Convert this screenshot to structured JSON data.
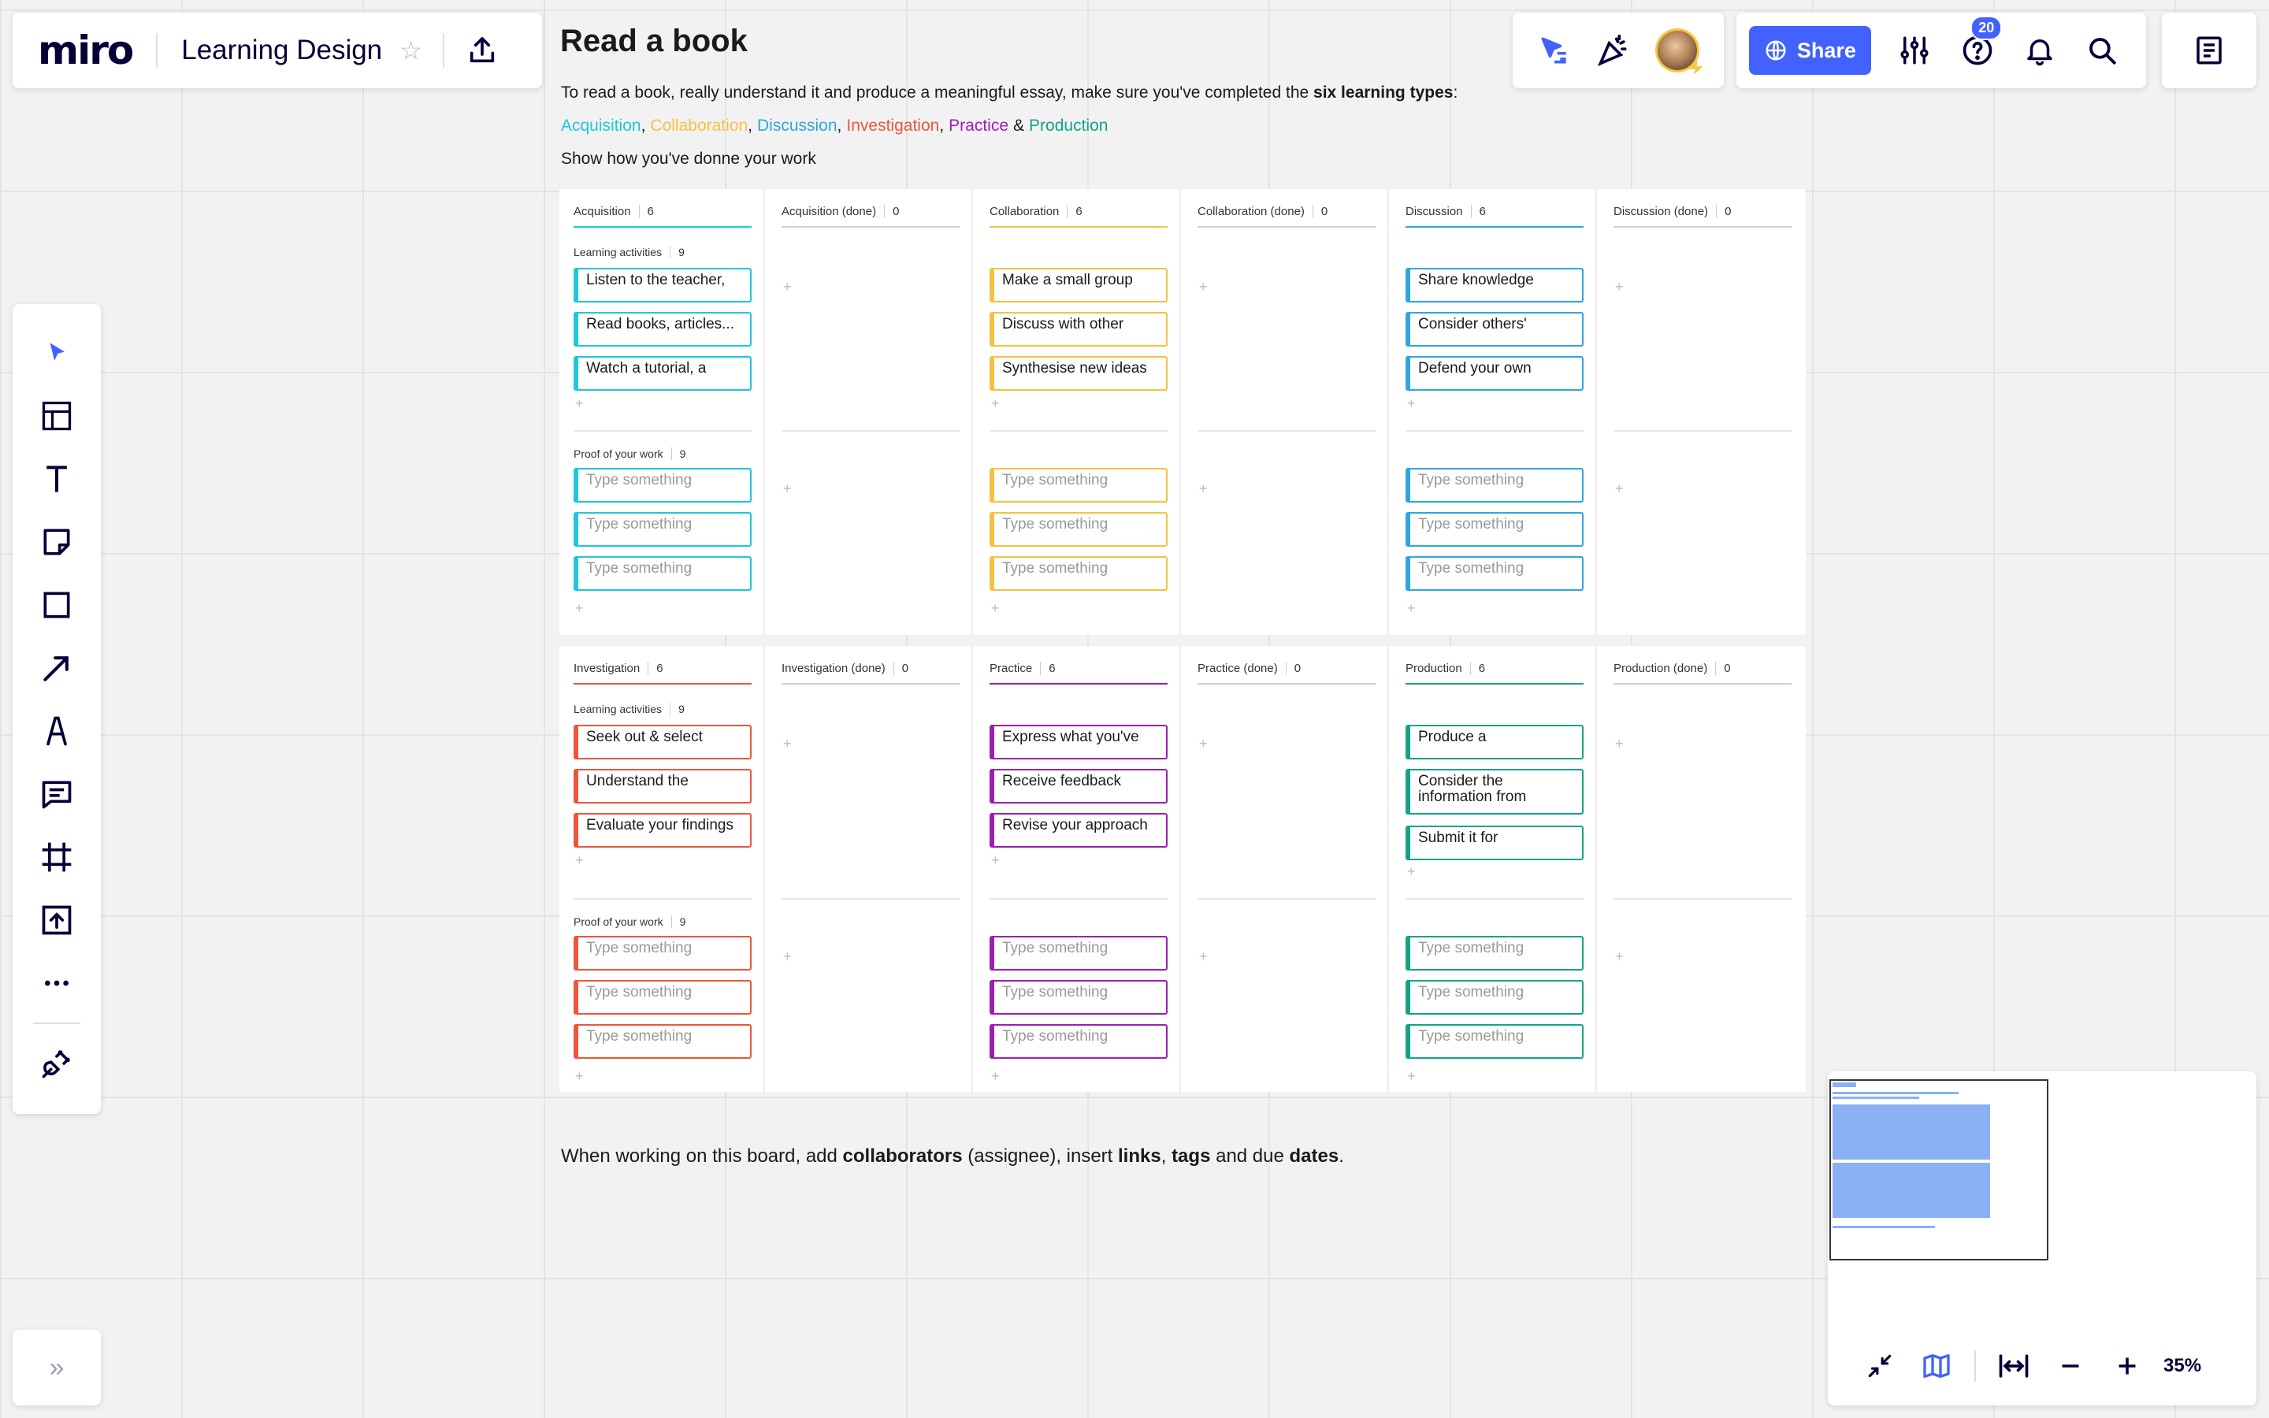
{
  "app": {
    "logo": "miro",
    "board_title": "Learning Design"
  },
  "header": {
    "share_label": "Share",
    "help_badge": "20"
  },
  "content": {
    "heading": "Read a book",
    "intro_prefix": "To read a book, really understand it and produce a meaningful essay, make sure you've completed the ",
    "intro_bold": "six learning types",
    "intro_suffix": ":",
    "types": [
      {
        "label": "Acquisition",
        "color": "#1ec8d8"
      },
      {
        "label": "Collaboration",
        "color": "#f5c242"
      },
      {
        "label": "Discussion",
        "color": "#2ea7e0"
      },
      {
        "label": "Investigation",
        "color": "#f0553a"
      },
      {
        "label": "Practice",
        "color": "#9b1fb0"
      },
      {
        "label": "Production",
        "color": "#14a388"
      }
    ],
    "sep_comma": ",",
    "sep_amp": "&",
    "show_work": "Show how you've donne your work",
    "footer": {
      "t1": "When working on this board, add ",
      "b1": "collaborators",
      "t2": " (assignee), insert ",
      "b2": "links",
      "t3": ", ",
      "b3": "tags",
      "t4": " and due ",
      "b4": "dates",
      "t5": "."
    }
  },
  "boards": [
    {
      "columns": [
        {
          "title": "Acquisition",
          "count": "6",
          "color": "#1ec8d8",
          "activities_label": "Learning activities",
          "activities_count": "9",
          "cards": [
            "Listen to the teacher,",
            "Read books, articles...",
            "Watch a tutorial, a"
          ],
          "proof_label": "Proof of your work",
          "proof_count": "9"
        },
        {
          "title": "Acquisition (done)",
          "count": "0"
        },
        {
          "title": "Collaboration",
          "count": "6",
          "color": "#f5c242",
          "cards": [
            "Make a small group",
            "Discuss with other",
            "Synthesise new ideas"
          ]
        },
        {
          "title": "Collaboration (done)",
          "count": "0"
        },
        {
          "title": "Discussion",
          "count": "6",
          "color": "#2ea7e0",
          "cards": [
            "Share knowledge",
            "Consider others'",
            "Defend your own"
          ]
        },
        {
          "title": "Discussion (done)",
          "count": "0"
        }
      ]
    },
    {
      "columns": [
        {
          "title": "Investigation",
          "count": "6",
          "color": "#f0553a",
          "activities_label": "Learning activities",
          "activities_count": "9",
          "cards": [
            "Seek out & select",
            "Understand the",
            "Evaluate your findings"
          ],
          "proof_label": "Proof of your work",
          "proof_count": "9"
        },
        {
          "title": "Investigation (done)",
          "count": "0"
        },
        {
          "title": "Practice",
          "count": "6",
          "color": "#9b1fb0",
          "cards": [
            "Express what you've",
            "Receive feedback",
            "Revise your approach"
          ]
        },
        {
          "title": "Practice (done)",
          "count": "0"
        },
        {
          "title": "Production",
          "count": "6",
          "color": "#14a388",
          "cards": [
            "Produce a",
            "Consider the information from",
            "Submit it for"
          ]
        },
        {
          "title": "Production (done)",
          "count": "0"
        }
      ]
    }
  ],
  "placeholder": "Type something",
  "plus": "+",
  "zoom": {
    "level": "35%"
  },
  "expand_label": "»"
}
